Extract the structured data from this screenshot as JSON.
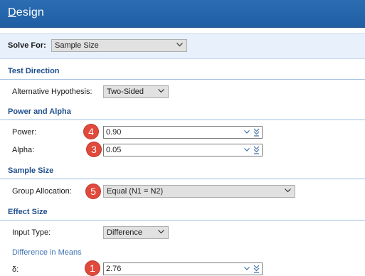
{
  "window": {
    "title_accel": "D",
    "title_rest": "esign"
  },
  "solve_for": {
    "label": "Solve For:",
    "value": "Sample Size"
  },
  "sections": {
    "test_direction": "Test Direction",
    "power_alpha": "Power and Alpha",
    "sample_size": "Sample Size",
    "effect_size": "Effect Size"
  },
  "fields": {
    "alt_hypothesis": {
      "label": "Alternative Hypothesis:",
      "value": "Two-Sided"
    },
    "power": {
      "label": "Power:",
      "value": "0.90",
      "step": "4"
    },
    "alpha": {
      "label": "Alpha:",
      "value": "0.05",
      "step": "3"
    },
    "group_allocation": {
      "label": "Group Allocation:",
      "value": "Equal (N1 = N2)",
      "step": "5"
    },
    "input_type": {
      "label": "Input Type:",
      "value": "Difference"
    },
    "difference_in_means": {
      "label": "Difference in Means"
    },
    "delta": {
      "label": "δ:",
      "value": "2.76",
      "step": "1"
    }
  },
  "colors": {
    "titlebar": "#1f5ea3",
    "section_text": "#1f4e8c",
    "badge": "#e0493b",
    "solvebar": "#e8f1fb"
  },
  "icons": {
    "dropdown": "chevron-down-icon",
    "expand": "double-chevron-down-icon"
  }
}
